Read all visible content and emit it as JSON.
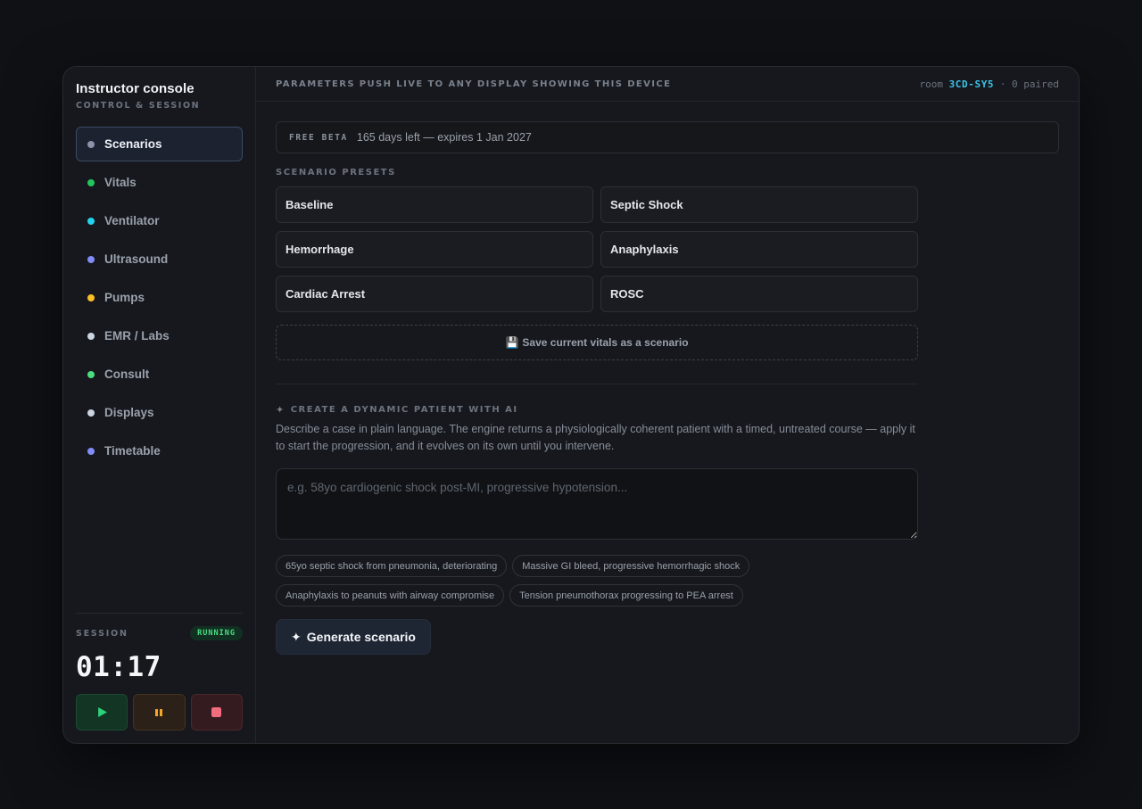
{
  "sidebar": {
    "title": "Instructor console",
    "subtitle": "CONTROL & SESSION",
    "items": [
      {
        "label": "Scenarios",
        "color": "#8b93a8",
        "active": true
      },
      {
        "label": "Vitals",
        "color": "#22c55e"
      },
      {
        "label": "Ventilator",
        "color": "#22d3ee"
      },
      {
        "label": "Ultrasound",
        "color": "#818cf8"
      },
      {
        "label": "Pumps",
        "color": "#fbbf24"
      },
      {
        "label": "EMR / Labs",
        "color": "#cbd5e1"
      },
      {
        "label": "Consult",
        "color": "#4ade80"
      },
      {
        "label": "Displays",
        "color": "#cbd5e1"
      },
      {
        "label": "Timetable",
        "color": "#818cf8"
      }
    ]
  },
  "session": {
    "label": "SESSION",
    "status": "RUNNING",
    "clock": "01:17",
    "controls": [
      "play-icon",
      "pause-icon",
      "stop-icon"
    ]
  },
  "topbar": {
    "message": "PARAMETERS PUSH LIVE TO ANY DISPLAY SHOWING THIS DEVICE",
    "room_prefix": "room",
    "room_code": "3CD-SY5",
    "paired": "· 0 paired"
  },
  "beta": {
    "tag": "FREE BETA",
    "text": "165 days left — expires 1 Jan 2027"
  },
  "presets": {
    "heading": "SCENARIO PRESETS",
    "items": [
      "Baseline",
      "Septic Shock",
      "Hemorrhage",
      "Anaphylaxis",
      "Cardiac Arrest",
      "ROSC"
    ],
    "save_label": "Save current vitals as a scenario",
    "save_icon": "💾"
  },
  "ai": {
    "heading": "CREATE A DYNAMIC PATIENT WITH AI",
    "icon": "✦",
    "description": "Describe a case in plain language. The engine returns a physiologically coherent patient with a timed, untreated course — apply it to start the progression, and it evolves on its own until you intervene.",
    "placeholder": "e.g. 58yo cardiogenic shock post-MI, progressive hypotension...",
    "value": "",
    "suggestions": [
      "65yo septic shock from pneumonia, deteriorating",
      "Massive GI bleed, progressive hemorrhagic shock",
      "Anaphylaxis to peanuts with airway compromise",
      "Tension pneumothorax progressing to PEA arrest"
    ],
    "generate_label": "Generate scenario"
  }
}
